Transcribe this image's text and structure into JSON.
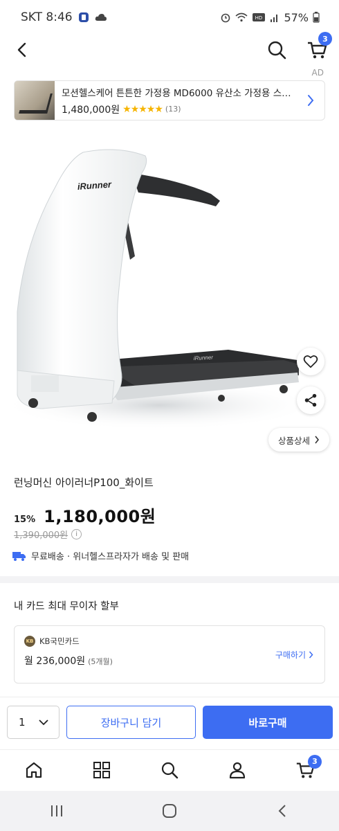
{
  "status_bar": {
    "carrier_time": "SKT 8:46",
    "battery": "57%"
  },
  "header": {
    "cart_count": "3"
  },
  "ad": {
    "label": "AD",
    "title": "모션헬스케어 튼튼한 가정용 MD6000 유산소 가정용 스…",
    "price": "1,480,000원",
    "stars": "★★★★★",
    "reviews": "(13)"
  },
  "product": {
    "brand_logo": "iRunner",
    "detail_button": "상품상세",
    "name": "런닝머신 아이러너P100_화이트",
    "discount_rate": "15%",
    "sale_price": "1,180,000원",
    "original_price": "1,390,000원",
    "info_mark": "i",
    "delivery_text": "무료배송 · 위너헬스프라자가 배송 및 판매"
  },
  "card_installment": {
    "section_title": "내 카드 최대 무이자 할부",
    "card_name": "KB국민카드",
    "card_logo_text": "KB",
    "monthly": "월 236,000원",
    "months": "(5개월)",
    "buy_link": "구매하기"
  },
  "purchase": {
    "quantity": "1",
    "add_to_cart": "장바구니 담기",
    "buy_now": "바로구매"
  },
  "bottom_nav": {
    "cart_count": "3"
  },
  "colors": {
    "accent": "#3d6df2",
    "star": "#f6b400"
  }
}
